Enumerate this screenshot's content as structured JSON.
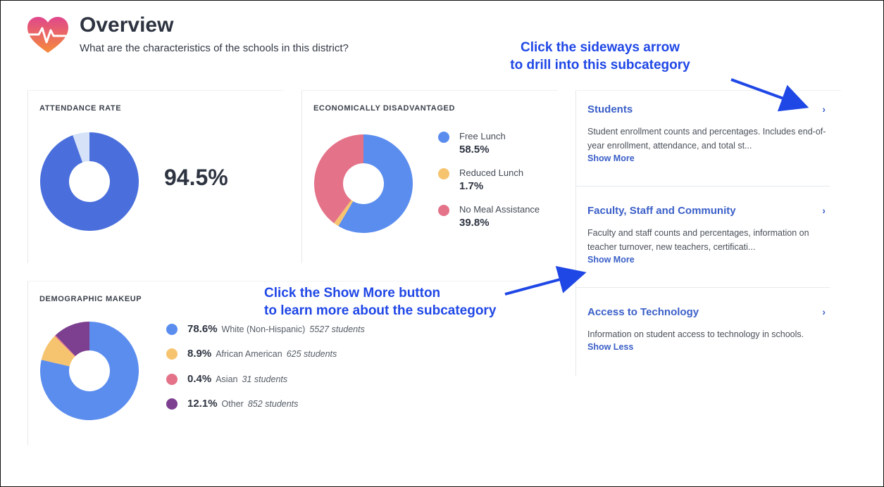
{
  "header": {
    "title": "Overview",
    "subtitle": "What are the characteristics of the schools in this district?"
  },
  "attendance": {
    "title": "ATTENDANCE RATE",
    "value": "94.5%",
    "rate": 0.945,
    "colors": {
      "main": "#4a6fdc",
      "rest": "#d5e2f7"
    }
  },
  "economic": {
    "title": "ECONOMICALLY DISADVANTAGED",
    "items": [
      {
        "label": "Free Lunch",
        "value": "58.5%",
        "pct": 58.5,
        "color": "#5b8def"
      },
      {
        "label": "Reduced Lunch",
        "value": "1.7%",
        "pct": 1.7,
        "color": "#f6c46f"
      },
      {
        "label": "No Meal Assistance",
        "value": "39.8%",
        "pct": 39.8,
        "color": "#e47288"
      }
    ]
  },
  "demographics": {
    "title": "DEMOGRAPHIC MAKEUP",
    "items": [
      {
        "pct_label": "78.6%",
        "label": "White (Non-Hispanic)",
        "count": "5527 students",
        "pct": 78.6,
        "color": "#5b8def"
      },
      {
        "pct_label": "8.9%",
        "label": "African American",
        "count": "625 students",
        "pct": 8.9,
        "color": "#f6c46f"
      },
      {
        "pct_label": "0.4%",
        "label": "Asian",
        "count": "31 students",
        "pct": 0.4,
        "color": "#e47288"
      },
      {
        "pct_label": "12.1%",
        "label": "Other",
        "count": "852 students",
        "pct": 12.1,
        "color": "#7d3f8f"
      }
    ]
  },
  "subcategories": [
    {
      "title": "Students",
      "description": "Student enrollment counts and percentages. Includes end-of-year enrollment, attendance, and total st...",
      "link": "Show More",
      "chevron": "›"
    },
    {
      "title": "Faculty, Staff and Community",
      "description": "Faculty and staff counts and percentages, information on teacher turnover, new teachers, certificati...",
      "link": "Show More",
      "chevron": "›"
    },
    {
      "title": "Access to Technology",
      "description": "Information on student access to technology in schools.",
      "link": "Show Less",
      "chevron": "›"
    }
  ],
  "annotations": {
    "arrow_top_line1": "Click the sideways arrow",
    "arrow_top_line2": "to drill into this subcategory",
    "show_more_line1": "Click the Show More button",
    "show_more_line2": "to learn more about the subcategory",
    "color": "#1f47e6"
  },
  "icons": {
    "logo": "heart-pulse-icon",
    "chevron": "chevron-right-icon"
  }
}
